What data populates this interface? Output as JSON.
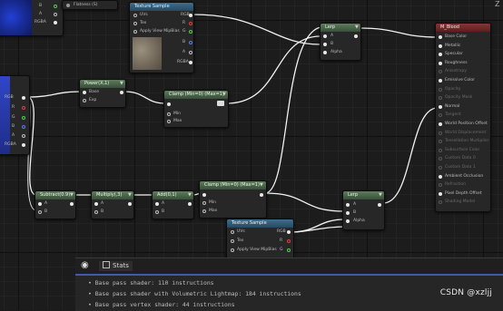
{
  "nodes": {
    "top_left_pins": {
      "b": "B",
      "a": "A",
      "rgba": "RGBA"
    },
    "flatness": {
      "label": "Flatness (S)"
    },
    "texture_sample_top": {
      "title": "Texture Sample",
      "pins_in": [
        "UVs",
        "Tex",
        "Apply View MipBias"
      ],
      "pins_out": [
        "RGB",
        "R",
        "G",
        "B",
        "A",
        "RGBA"
      ]
    },
    "left_panel": {
      "pins": [
        "RGB",
        "R",
        "G",
        "B",
        "A",
        "RGBA"
      ]
    },
    "power": {
      "title": "Power(X,1)",
      "pins": [
        "Base",
        "Exp"
      ]
    },
    "clamp_top": {
      "title": "Clamp (Min=0) (Max=1)",
      "pins": [
        "Min",
        "Max"
      ]
    },
    "lerp_top": {
      "title": "Lerp",
      "pins": [
        "A",
        "B",
        "Alpha"
      ]
    },
    "subtract": {
      "title": "Subtract(0.9)",
      "pins": [
        "A",
        "B"
      ]
    },
    "multiply": {
      "title": "Multiply(,3)",
      "pins": [
        "A",
        "B"
      ]
    },
    "add": {
      "title": "Add(0,1)",
      "pins": [
        "A",
        "B"
      ]
    },
    "clamp_mid": {
      "title": "Clamp (Min=0) (Max=1)",
      "pins": [
        "Min",
        "Max"
      ]
    },
    "texture_sample_bottom": {
      "title": "Texture Sample",
      "pins_in": [
        "UVs",
        "Tex",
        "Apply View MipBias"
      ],
      "pins_out": [
        "RGB",
        "R",
        "G"
      ]
    },
    "lerp_bottom": {
      "title": "Lerp",
      "pins": [
        "A",
        "B",
        "Alpha"
      ]
    },
    "material": {
      "title": "M_Blood",
      "pins": [
        {
          "label": "Base Color",
          "active": true
        },
        {
          "label": "Metallic",
          "active": true
        },
        {
          "label": "Specular",
          "active": true
        },
        {
          "label": "Roughness",
          "active": true
        },
        {
          "label": "Anisotropy",
          "active": false
        },
        {
          "label": "Emissive Color",
          "active": true
        },
        {
          "label": "Opacity",
          "active": false
        },
        {
          "label": "Opacity Mask",
          "active": false
        },
        {
          "label": "Normal",
          "active": true
        },
        {
          "label": "Tangent",
          "active": false
        },
        {
          "label": "World Position Offset",
          "active": true
        },
        {
          "label": "World Displacement",
          "active": false
        },
        {
          "label": "Tessellation Multiplier",
          "active": false
        },
        {
          "label": "Subsurface Color",
          "active": false
        },
        {
          "label": "Custom Data 0",
          "active": false
        },
        {
          "label": "Custom Data 1",
          "active": false
        },
        {
          "label": "Ambient Occlusion",
          "active": true
        },
        {
          "label": "Refraction",
          "active": false
        },
        {
          "label": "Pixel Depth Offset",
          "active": true
        },
        {
          "label": "Shading Model",
          "active": false
        }
      ]
    }
  },
  "stats": {
    "tab_label": "Stats",
    "lines": [
      "Base pass shader: 110 instructions",
      "Base pass shader with Volumetric Lightmap: 184 instructions",
      "Base pass vertex shader: 44 instructions"
    ]
  },
  "corner_label": "Z",
  "watermark": "CSDN @xzljj"
}
